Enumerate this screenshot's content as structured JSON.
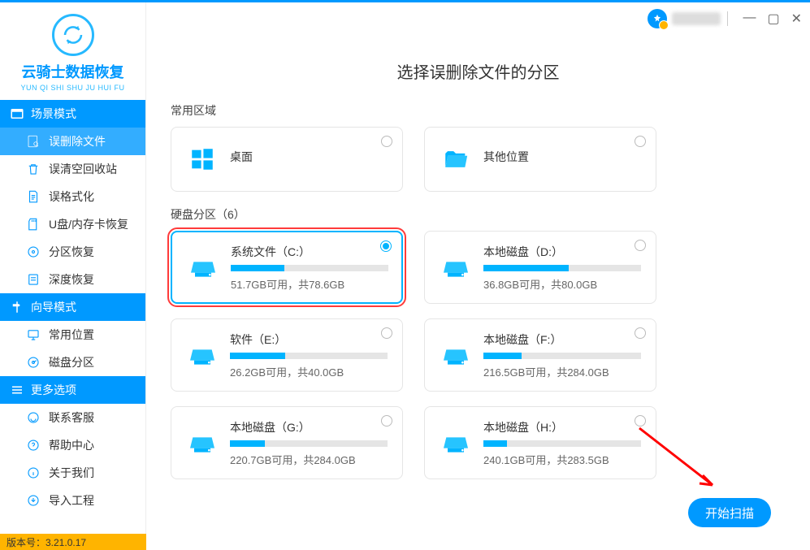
{
  "app": {
    "name": "云骑士数据恢复",
    "sub": "YUN QI SHI SHU JU HUI FU"
  },
  "titlebar": {
    "minimize": "—",
    "maximize": "▢",
    "close": "✕"
  },
  "sidebar": {
    "scene_mode": "场景模式",
    "scene_items": [
      "误删除文件",
      "误清空回收站",
      "误格式化",
      "U盘/内存卡恢复",
      "分区恢复",
      "深度恢复"
    ],
    "wizard_mode": "向导模式",
    "wizard_items": [
      "常用位置",
      "磁盘分区"
    ],
    "more": "更多选项",
    "more_items": [
      "联系客服",
      "帮助中心",
      "关于我们",
      "导入工程"
    ]
  },
  "version": "版本号：3.21.0.17",
  "main": {
    "title": "选择误删除文件的分区",
    "common_label": "常用区域",
    "common_cards": [
      {
        "label": "桌面"
      },
      {
        "label": "其他位置"
      }
    ],
    "part_label": "硬盘分区（6）",
    "partitions": [
      {
        "title": "系统文件（C:）",
        "sub": "51.7GB可用，共78.6GB",
        "pct": 34,
        "selected": true
      },
      {
        "title": "本地磁盘（D:）",
        "sub": "36.8GB可用，共80.0GB",
        "pct": 54
      },
      {
        "title": "软件（E:）",
        "sub": "26.2GB可用，共40.0GB",
        "pct": 35
      },
      {
        "title": "本地磁盘（F:）",
        "sub": "216.5GB可用，共284.0GB",
        "pct": 24
      },
      {
        "title": "本地磁盘（G:）",
        "sub": "220.7GB可用，共284.0GB",
        "pct": 22
      },
      {
        "title": "本地磁盘（H:）",
        "sub": "240.1GB可用，共283.5GB",
        "pct": 15
      }
    ],
    "scan_btn": "开始扫描"
  }
}
